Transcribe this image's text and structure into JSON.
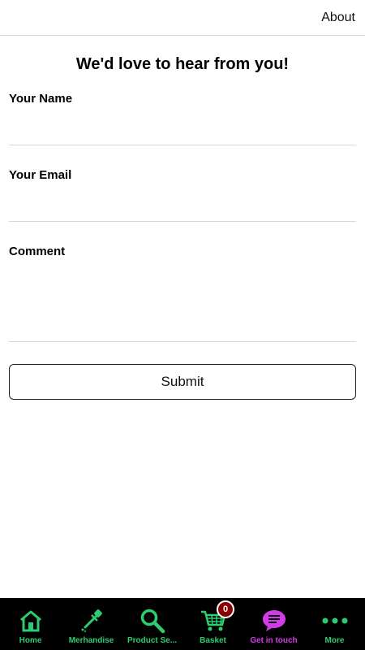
{
  "topbar": {
    "about_label": "About"
  },
  "heading": "We'd love to hear from you!",
  "form": {
    "name_label": "Your Name",
    "name_value": "",
    "email_label": "Your Email",
    "email_value": "",
    "comment_label": "Comment",
    "comment_value": "",
    "submit_label": "Submit"
  },
  "tabbar": {
    "tabs": [
      {
        "label": "Home",
        "icon": "home-icon",
        "color": "#2ecc71"
      },
      {
        "label": "Merhandise",
        "icon": "dropper-icon",
        "color": "#2ecc71"
      },
      {
        "label": "Product Se...",
        "icon": "search-icon",
        "color": "#2ecc71"
      },
      {
        "label": "Basket",
        "icon": "cart-icon",
        "color": "#2ecc71",
        "badge": "0"
      },
      {
        "label": "Get in touch",
        "icon": "chat-icon",
        "color": "#d23be7",
        "active": true
      },
      {
        "label": "More",
        "icon": "more-icon",
        "color": "#2ecc71"
      }
    ]
  },
  "colors": {
    "tab_green": "#2ecc71",
    "tab_active": "#d23be7",
    "badge": "#8b0000",
    "tabbar_bg": "#000000"
  }
}
